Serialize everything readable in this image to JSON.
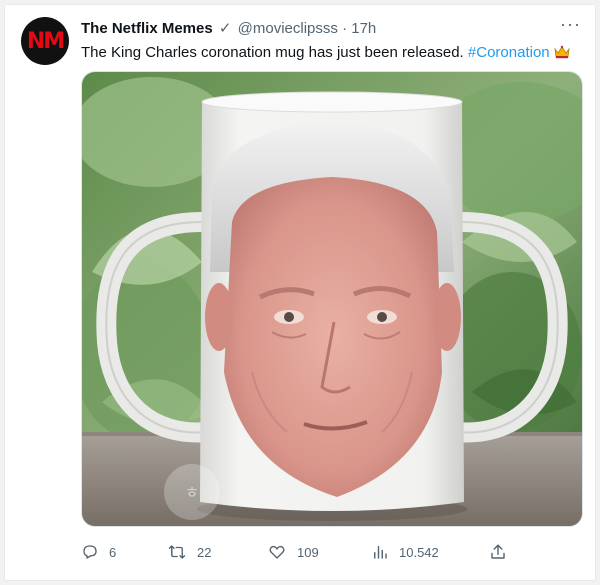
{
  "tweet": {
    "avatar_text": "NM",
    "author_name": "The Netflix Memes",
    "verified_mark": "✓",
    "handle": "@movieclipsss",
    "separator": "·",
    "time": "17h",
    "more": "···",
    "text": "The King Charles coronation mug has just been released.",
    "hashtag": "#Coronation",
    "colors": {
      "link": "#1d9bf0",
      "muted": "#536471",
      "avatar_bg": "#111111",
      "avatar_logo": "#e50914"
    }
  },
  "media": {
    "icon": "photo-of-face-mug"
  },
  "actions": {
    "replies": "6",
    "retweets": "22",
    "likes": "109",
    "views": "10.542"
  }
}
